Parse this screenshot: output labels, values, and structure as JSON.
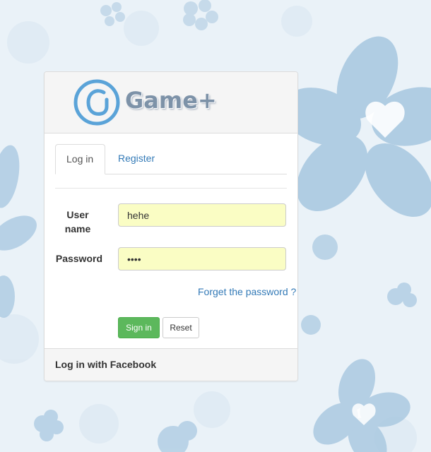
{
  "brand": {
    "name": "Game+",
    "logo_icon": "game-plus-logo-icon",
    "logo_color": "#62a6d8",
    "text_color": "#7d92a8"
  },
  "tabs": [
    {
      "label": "Log in",
      "active": true
    },
    {
      "label": "Register",
      "active": false
    }
  ],
  "form": {
    "username_label": "User name",
    "username_value": "hehe",
    "password_label": "Password",
    "password_value": "••••",
    "input_background": "#fafdc4"
  },
  "links": {
    "forgot_password": "Forget the password ?"
  },
  "buttons": {
    "signin_label": "Sign in",
    "reset_label": "Reset",
    "signin_color": "#5cb85c"
  },
  "footer": {
    "facebook_text": "Log in with Facebook"
  },
  "colors": {
    "link": "#337ab7",
    "background": "#e9f2f8",
    "flower": "#9fc2de"
  }
}
